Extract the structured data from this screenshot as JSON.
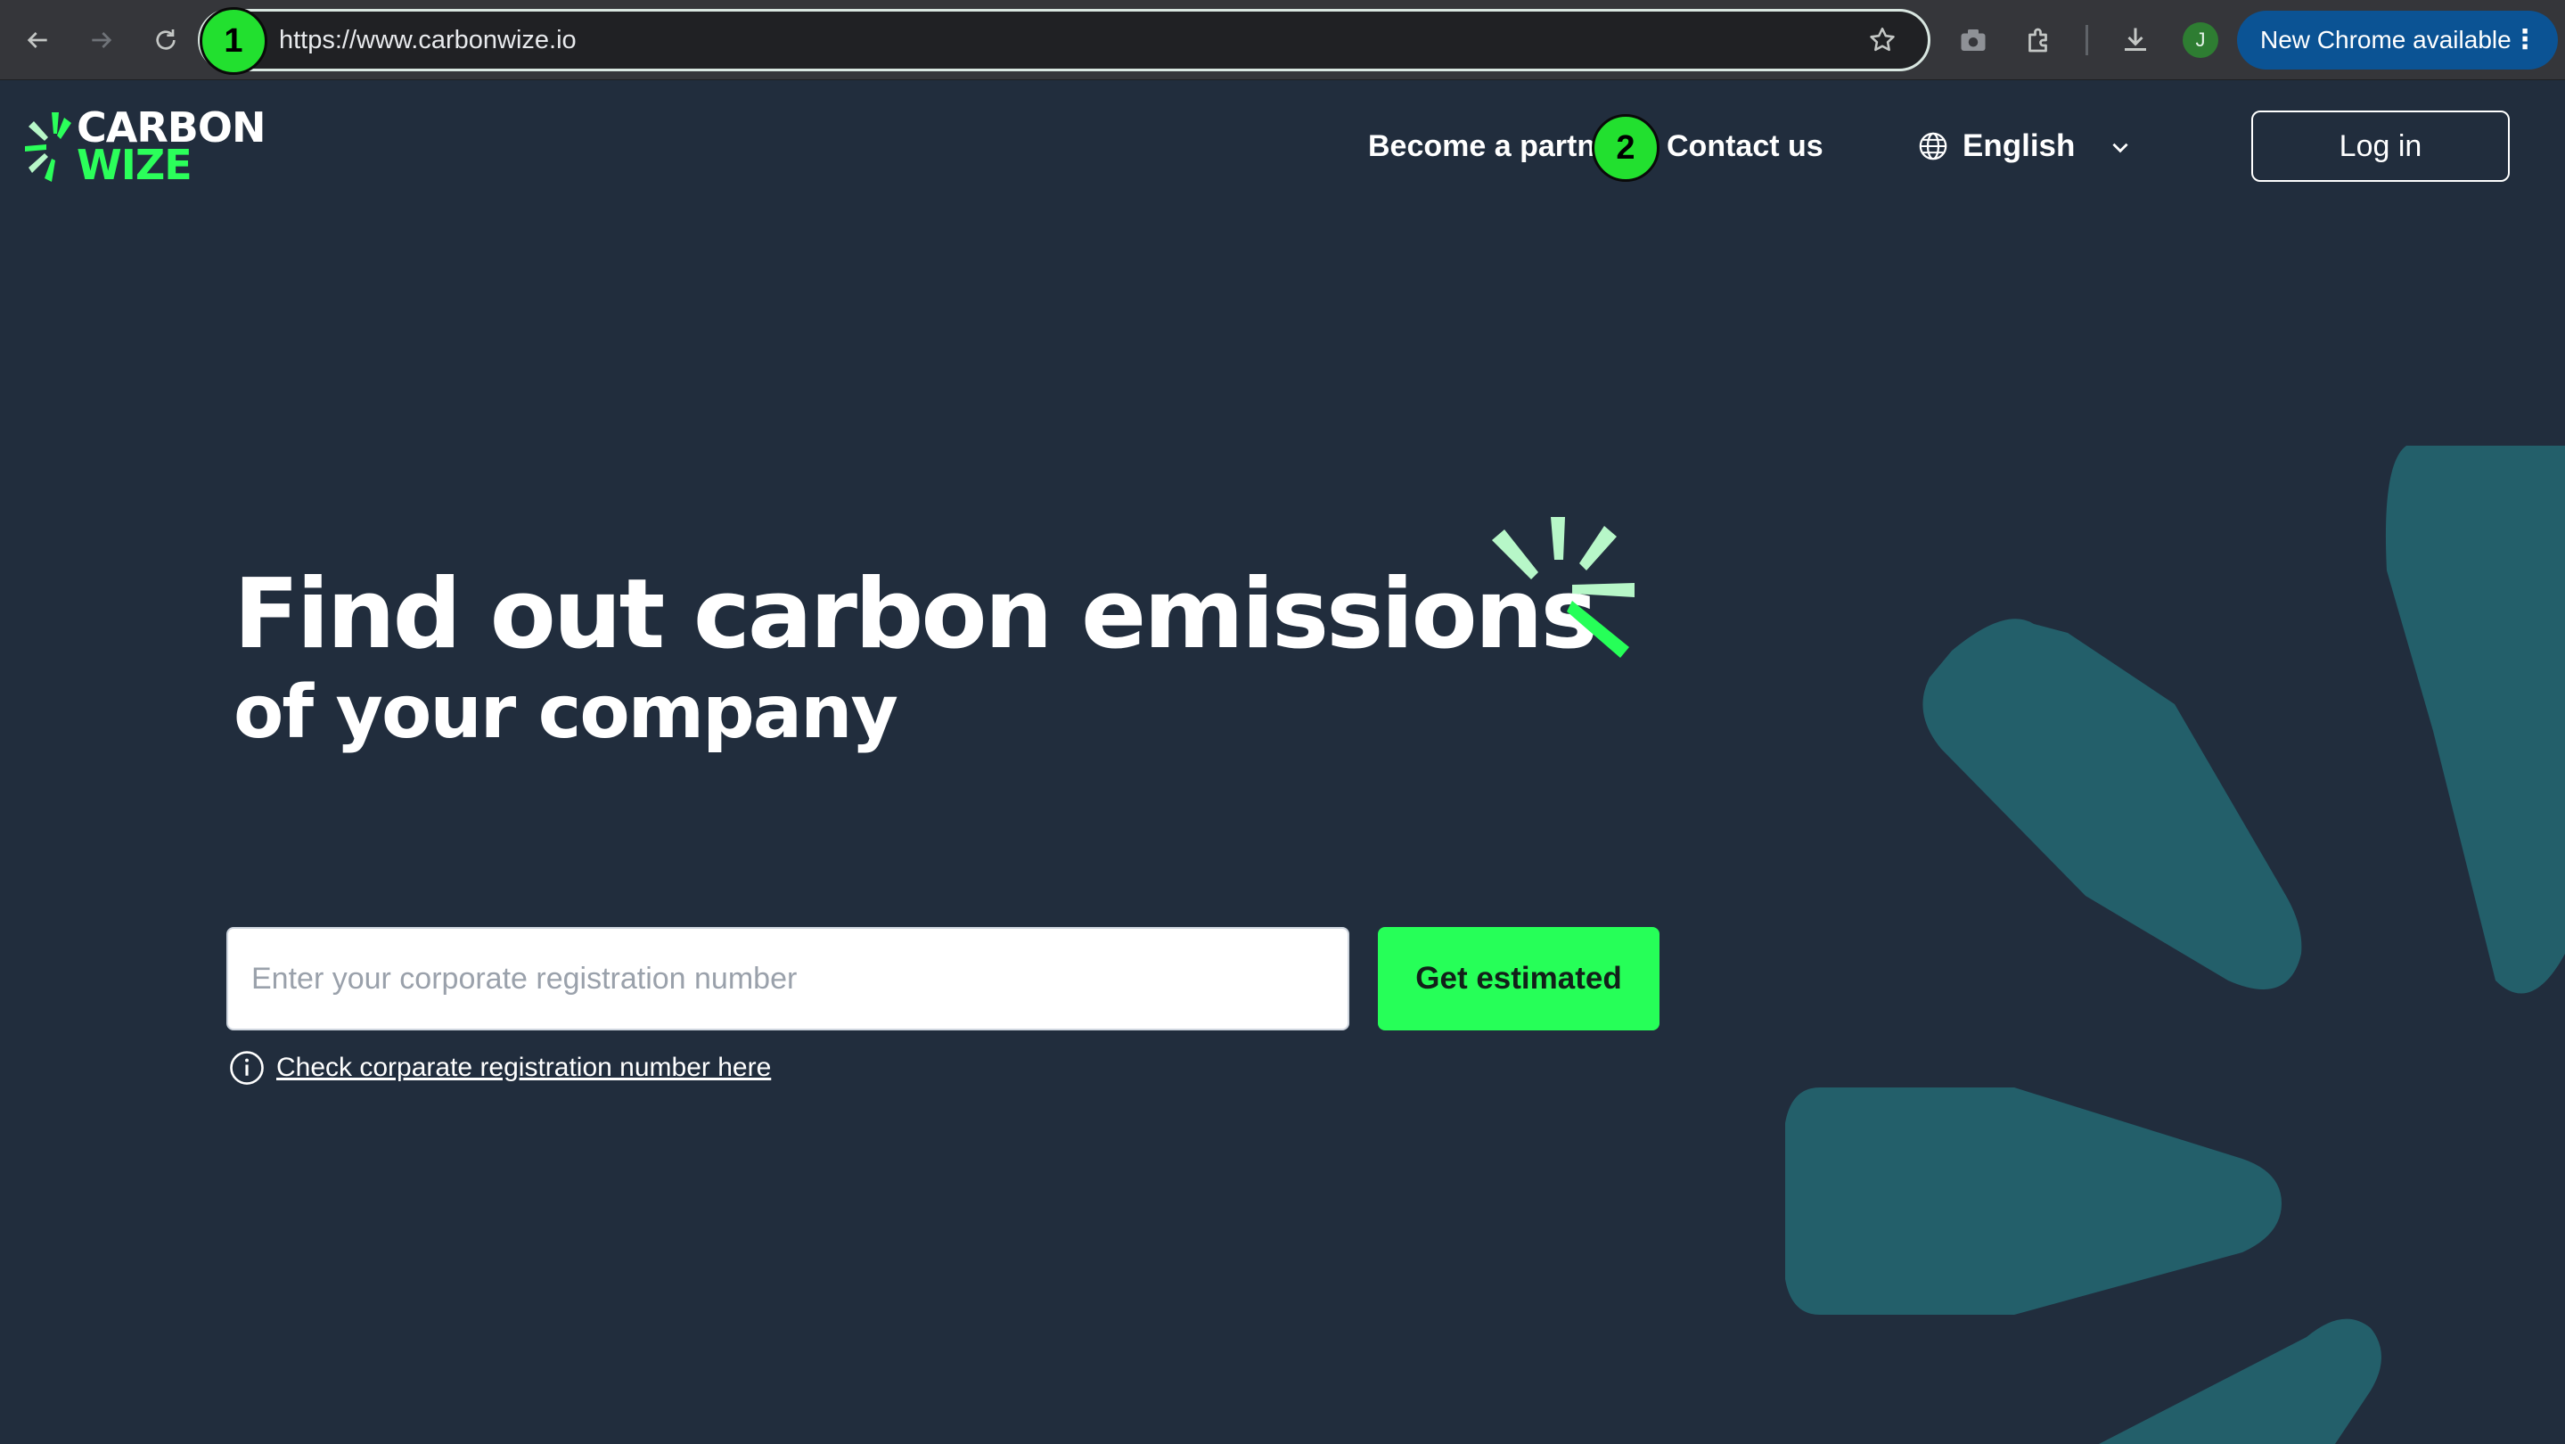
{
  "browser": {
    "url": "https://www.carbonwize.io",
    "profile_initial": "J",
    "update_label": "New Chrome available",
    "update_menu": "⋮"
  },
  "annotations": {
    "marker_1": "1",
    "marker_2": "2"
  },
  "site": {
    "logo": {
      "line1": "CARBON",
      "line2": "WIZE"
    },
    "nav": {
      "partner": "Become a partner",
      "contact": "Contact us",
      "language": "English",
      "login": "Log in"
    },
    "hero": {
      "title": "Find out carbon emissions",
      "subtitle": "of your company"
    },
    "search": {
      "placeholder": "Enter your corporate registration number",
      "button": "Get estimated",
      "help_link": "Check corparate registration number here"
    }
  },
  "colors": {
    "page_bg": "#212d3d",
    "accent_green": "#26ff58",
    "light_green": "#b7f7c8",
    "decor_teal": "#235f6a",
    "chrome_bar": "#35363a",
    "update_blue": "#0b5394"
  }
}
